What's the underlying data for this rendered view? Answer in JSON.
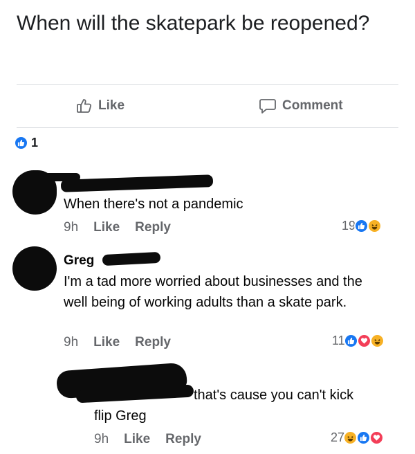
{
  "post": {
    "text": "When will the skatepark be reopened?",
    "like_label": "Like",
    "comment_label": "Comment",
    "reaction_count": "1"
  },
  "comments": [
    {
      "name": "",
      "text": "When there's not a pandemic",
      "time": "9h",
      "like_label": "Like",
      "reply_label": "Reply",
      "reaction_count": "19",
      "reactions": [
        "like-icon",
        "haha-icon"
      ]
    },
    {
      "name": "Greg",
      "text": "I'm a tad more worried about businesses and the well being of working adults than a skate park.",
      "time": "9h",
      "like_label": "Like",
      "reply_label": "Reply",
      "reaction_count": "11",
      "reactions": [
        "like-icon",
        "love-icon",
        "haha-icon"
      ]
    },
    {
      "name": "",
      "text": "that's cause you can't kick",
      "text_line2": "flip Greg",
      "time": "9h",
      "like_label": "Like",
      "reply_label": "Reply",
      "reaction_count": "27",
      "reactions": [
        "haha-icon",
        "like-icon",
        "love-icon"
      ]
    }
  ],
  "colors": {
    "like_blue": "#1877f2",
    "love_red": "#f33e58",
    "haha_yellow": "#f7b125",
    "meta_gray": "#65676b"
  }
}
